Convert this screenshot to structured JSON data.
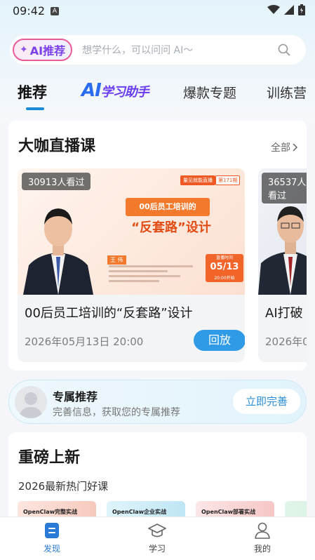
{
  "status_bar": {
    "time": "09:42",
    "notification_glyph": "A"
  },
  "search": {
    "ai_label": "AI推荐",
    "placeholder": "想学什么，可以问问 AI～"
  },
  "tabs": [
    {
      "label": "推荐",
      "active": true
    },
    {
      "label": "AI学习助手",
      "logo_main": "AI",
      "logo_sub": "学习助手",
      "active": false
    },
    {
      "label": "爆款专题",
      "active": false
    },
    {
      "label": "训练营",
      "active": false
    }
  ],
  "live_section": {
    "title": "大咖直播课",
    "see_all": "全部",
    "courses": [
      {
        "viewers": "30913人看过",
        "title": "00后员工培训的“反套路”设计",
        "time": "2026年05月13日 20:00",
        "action": "回放",
        "poster": {
          "tag": "量见就能直播",
          "episode": "第171期",
          "headline_top": "00后员工培训的",
          "headline_main": "“反套路”设计",
          "speaker": "王 伟",
          "date": "05/13",
          "date_label": "直播时间",
          "date_time": "20:00开始"
        }
      },
      {
        "viewers": "36537人看过",
        "title": "AI打破",
        "time": "2026年0"
      }
    ]
  },
  "recommend": {
    "title": "专属推荐",
    "subtitle": "完善信息，获取您的专属推荐",
    "button": "立即完善"
  },
  "new_section": {
    "title": "重磅上新",
    "subtitle": "2026最新热门好课",
    "thumbs": [
      "OpenClaw完整实战",
      "OpenClaw企业实战",
      "OpenClaw部署实战",
      ""
    ]
  },
  "bottom_nav": [
    {
      "label": "发现",
      "icon": "discover-icon",
      "active": true
    },
    {
      "label": "学习",
      "icon": "graduation-cap-icon",
      "active": false
    },
    {
      "label": "我的",
      "icon": "user-icon",
      "active": false
    }
  ],
  "colors": {
    "accent": "#2f9be6",
    "ai_pink": "#e85a9a",
    "poster_orange": "#f37a2c"
  }
}
